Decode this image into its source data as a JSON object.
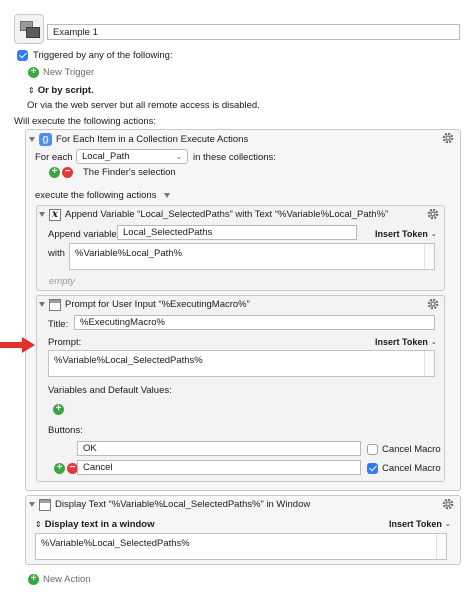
{
  "macro": {
    "name": "Example 1",
    "triggered_label": "Triggered by any of the following:",
    "triggered_checked": true,
    "new_trigger_label": "New Trigger",
    "or_by_script_label": "Or by script.",
    "web_server_text": "Or via the web server but all remote access is disabled.",
    "will_execute_label": "Will execute the following actions:",
    "new_action_label": "New Action"
  },
  "for_each": {
    "title": "For Each Item in a Collection Execute Actions",
    "for_each_label": "For each",
    "variable_value": "Local_Path",
    "in_these_label": "in these collections:",
    "collection_item": "The Finder's selection",
    "execute_label": "execute the following actions"
  },
  "append": {
    "title": "Append Variable “Local_SelectedPaths” with Text “%Variable%Local_Path%”",
    "append_label": "Append variable",
    "variable_value": "Local_SelectedPaths",
    "insert_token_label": "Insert Token",
    "with_label": "with",
    "text_value": "%Variable%Local_Path%",
    "empty_label": "empty"
  },
  "prompt": {
    "title": "Prompt for User Input “%ExecutingMacro%”",
    "title_label": "Title:",
    "title_value": "%ExecutingMacro%",
    "prompt_label": "Prompt:",
    "insert_token_label": "Insert Token",
    "prompt_value": "%Variable%Local_SelectedPaths%",
    "variables_label": "Variables and Default Values:",
    "buttons_label": "Buttons:",
    "buttons": [
      {
        "label": "OK",
        "cancel_macro_label": "Cancel Macro",
        "cancel_checked": false
      },
      {
        "label": "Cancel",
        "cancel_macro_label": "Cancel Macro",
        "cancel_checked": true
      }
    ]
  },
  "display": {
    "title": "Display Text “%Variable%Local_SelectedPaths%” in Window",
    "mode_label": "Display text in a window",
    "insert_token_label": "Insert Token",
    "text_value": "%Variable%Local_SelectedPaths%"
  },
  "colors": {
    "accent_blue": "#2f7cf6",
    "add_green": "#3aa842",
    "remove_red": "#e0393b",
    "arrow_red": "#e0302a"
  },
  "icons": [
    "macro-icon",
    "plus-icon",
    "minus-icon",
    "gear-icon",
    "loop-icon",
    "variable-icon",
    "window-icon",
    "arrow-icon"
  ]
}
